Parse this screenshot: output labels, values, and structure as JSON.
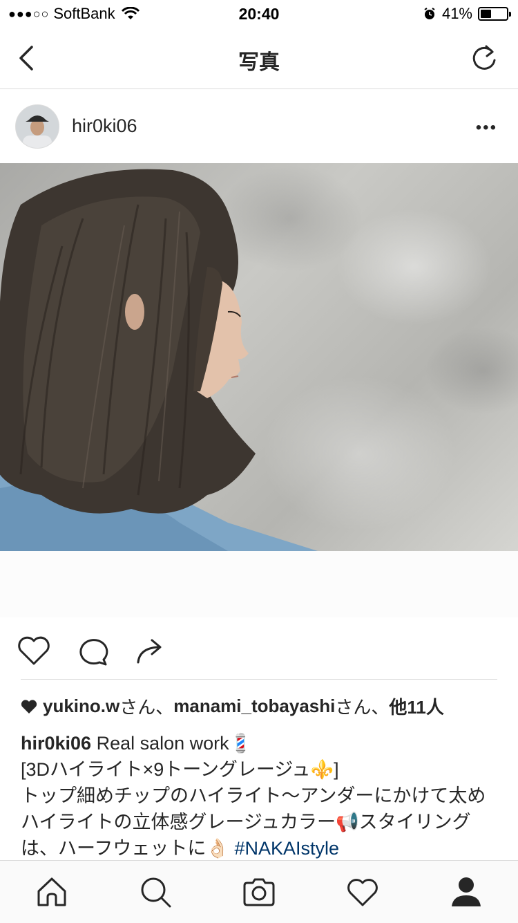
{
  "status_bar": {
    "signal": "●●●○○",
    "carrier": "SoftBank",
    "time": "20:40",
    "battery_text": "41%",
    "battery_level": 0.41
  },
  "nav": {
    "title": "写真"
  },
  "post": {
    "username": "hir0ki06",
    "more_label": "•••",
    "likes": {
      "user1": "yukino.w",
      "suffix1": "さん、",
      "user2": "manami_tobayashi",
      "suffix2": "さん、",
      "others": "他11人"
    },
    "caption": {
      "username": "hir0ki06",
      "line1": " Real salon work💈",
      "line2": "[3Dハイライト×9トーングレージュ⚜️]",
      "body": "トップ細めチップのハイライト〜アンダーにかけて太めハイライトの立体感グレージュカラー📢スタイリングは、ハーフウェットに👌🏻 ",
      "hashtag": "#NAKAIstyle"
    }
  },
  "icons": {
    "back": "chevron-left-icon",
    "refresh": "refresh-icon",
    "like": "heart-icon",
    "comment": "comment-icon",
    "share": "share-icon",
    "home": "home-icon",
    "search": "search-icon",
    "camera": "camera-icon",
    "activity": "heart-icon",
    "profile": "profile-icon"
  }
}
